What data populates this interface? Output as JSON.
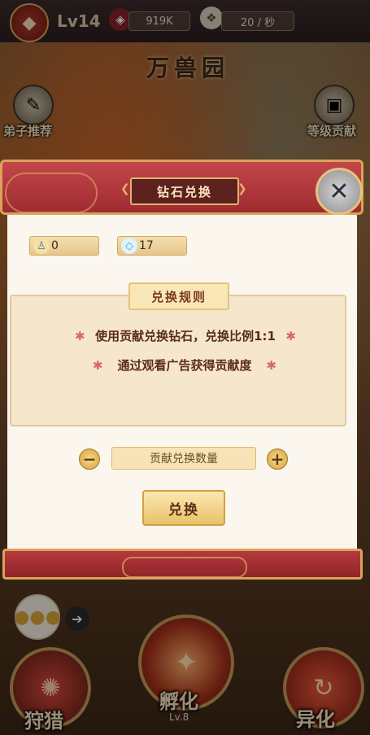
{
  "topbar": {
    "level": "Lv14",
    "currency1": "919K",
    "currency2": "20 / 秒"
  },
  "scene": {
    "title": "万兽园",
    "left_button": "弟子推荐",
    "right_button": "等级贡献"
  },
  "modal": {
    "title": "钻石兑换",
    "contribution_value": "0",
    "diamond_value": "17",
    "rules_title": "兑换规则",
    "rules": [
      "使用贡献兑换钻石，兑换比例1:1",
      "通过观看广告获得贡献度"
    ],
    "quantity_placeholder": "贡献兑换数量",
    "exchange_label": "兑换"
  },
  "bottom": {
    "left_label": "狩猎",
    "center_label": "孵化",
    "center_level": "Lv.8",
    "right_label": "异化"
  },
  "colors": {
    "modal_red": "#9e2b31",
    "gold_border": "#d9a35a",
    "body_bg": "#fbf6ee"
  }
}
